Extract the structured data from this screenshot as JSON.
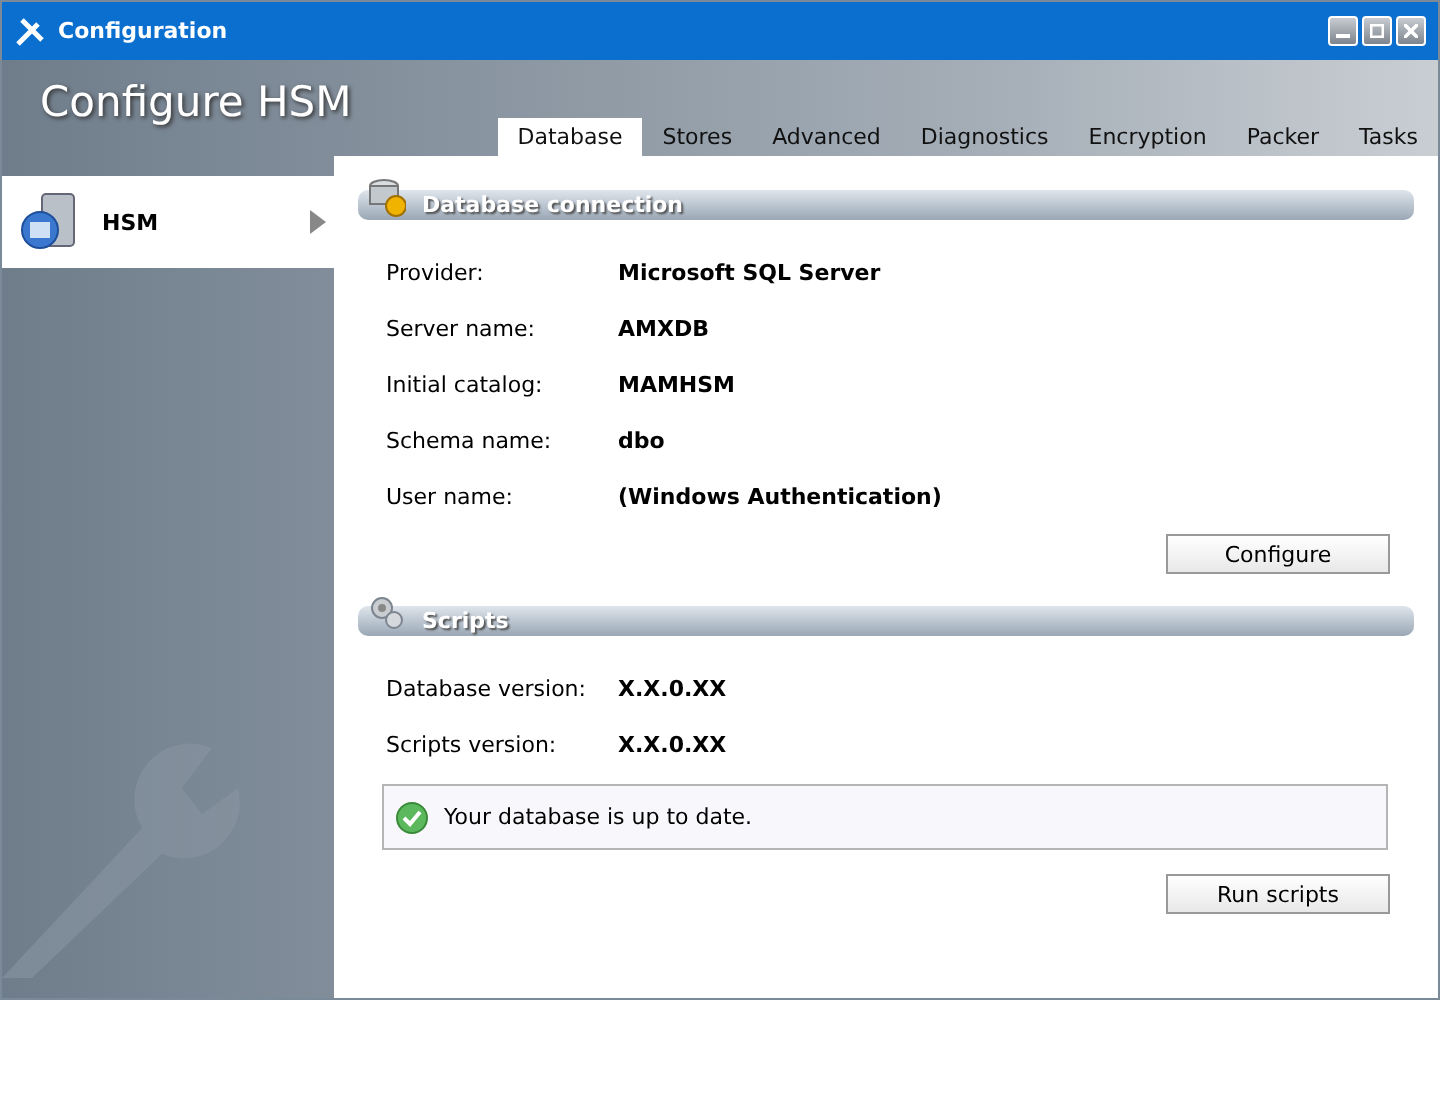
{
  "window": {
    "title": "Configuration"
  },
  "header": {
    "title": "Configure HSM"
  },
  "tabs": [
    {
      "label": "Database",
      "selected": true
    },
    {
      "label": "Stores",
      "selected": false
    },
    {
      "label": "Advanced",
      "selected": false
    },
    {
      "label": "Diagnostics",
      "selected": false
    },
    {
      "label": "Encryption",
      "selected": false
    },
    {
      "label": "Packer",
      "selected": false
    },
    {
      "label": "Tasks",
      "selected": false
    }
  ],
  "sidebar": {
    "items": [
      {
        "label": "HSM",
        "selected": true
      }
    ]
  },
  "sections": [
    {
      "kind": "database",
      "title": "Database connection",
      "fields": [
        {
          "label": "Provider:",
          "value": "Microsoft SQL Server"
        },
        {
          "label": "Server name:",
          "value": "AMXDB"
        },
        {
          "label": "Initial catalog:",
          "value": "MAMHSM"
        },
        {
          "label": "Schema name:",
          "value": "dbo"
        },
        {
          "label": "User name:",
          "value": "(Windows Authentication)"
        }
      ],
      "button": "Configure"
    },
    {
      "kind": "scripts",
      "title": "Scripts",
      "fields": [
        {
          "label": "Database version:",
          "value": "X.X.0.XX"
        },
        {
          "label": "Scripts version:",
          "value": "X.X.0.XX"
        }
      ],
      "status": "Your database is up to date.",
      "button": "Run scripts"
    }
  ]
}
